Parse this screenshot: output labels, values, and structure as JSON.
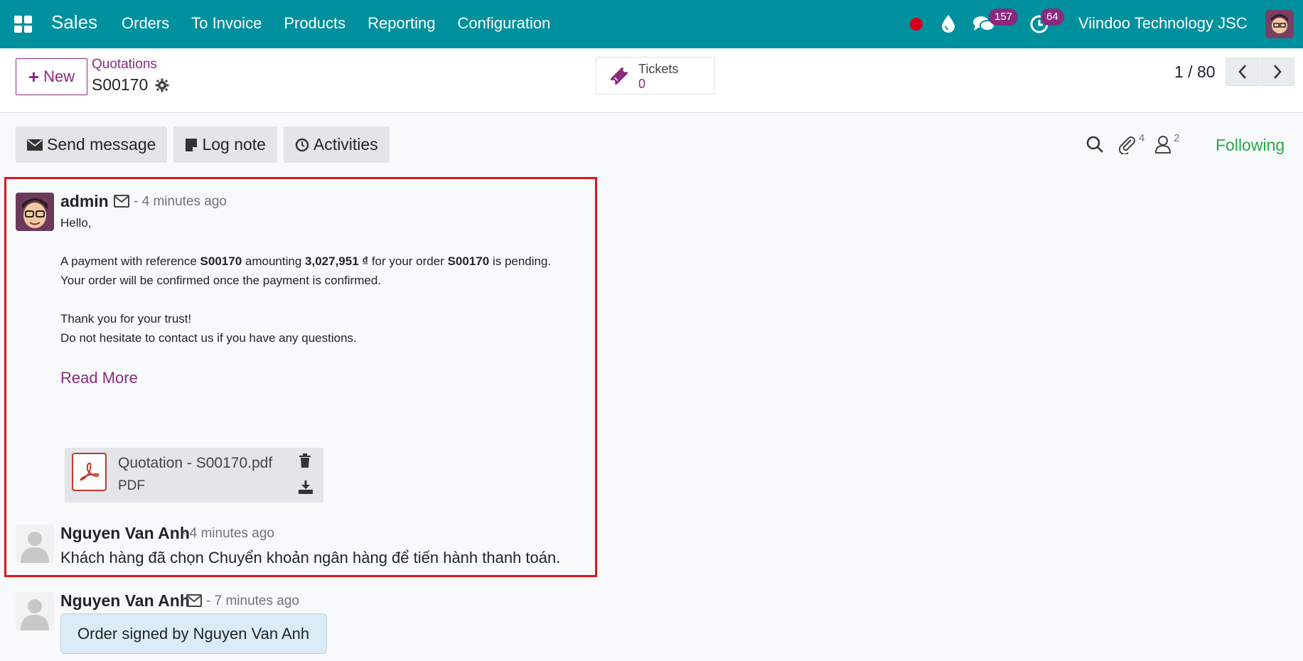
{
  "navbar": {
    "brand": "Sales",
    "menu": [
      "Orders",
      "To Invoice",
      "Products",
      "Reporting",
      "Configuration"
    ],
    "chat_badge": "157",
    "activity_badge": "64",
    "company": "Viindoo Technology JSC"
  },
  "control": {
    "new_label": "New",
    "breadcrumb": "Quotations",
    "record": "S00170",
    "tickets_label": "Tickets",
    "tickets_count": "0",
    "pager": "1 / 80"
  },
  "chatter": {
    "send_message": "Send message",
    "log_note": "Log note",
    "activities": "Activities",
    "attachments_count": "4",
    "followers_count": "2",
    "following": "Following"
  },
  "messages": {
    "m1": {
      "author": "admin",
      "time": "- 4 minutes ago",
      "greeting": "Hello,",
      "line1_a": "A payment with reference ",
      "line1_ref": "S00170",
      "line1_b": " amounting ",
      "line1_amount": "3,027,951 ₫",
      "line1_c": " for your order ",
      "line1_order": "S00170",
      "line1_d": " is pending.",
      "line2": "Your order will be confirmed once the payment is confirmed.",
      "line3": "Thank you for your trust!",
      "line4": "Do not hesitate to contact us if you have any questions.",
      "read_more": "Read More",
      "attachment_name": "Quotation - S00170.pdf",
      "attachment_type": "PDF"
    },
    "m2": {
      "author": "Nguyen Van Anh",
      "time": "- 4 minutes ago",
      "text": "Khách hàng đã chọn Chuyển khoản ngân hàng để tiến hành thanh toán."
    },
    "m3": {
      "author": "Nguyen Van Anh",
      "time": "- 7 minutes ago",
      "text": "Order signed by Nguyen Van Anh"
    }
  },
  "colors": {
    "navbar": "#00909e",
    "accent": "#8a2a7f",
    "following": "#28a745",
    "highlight": "#e0141f"
  }
}
